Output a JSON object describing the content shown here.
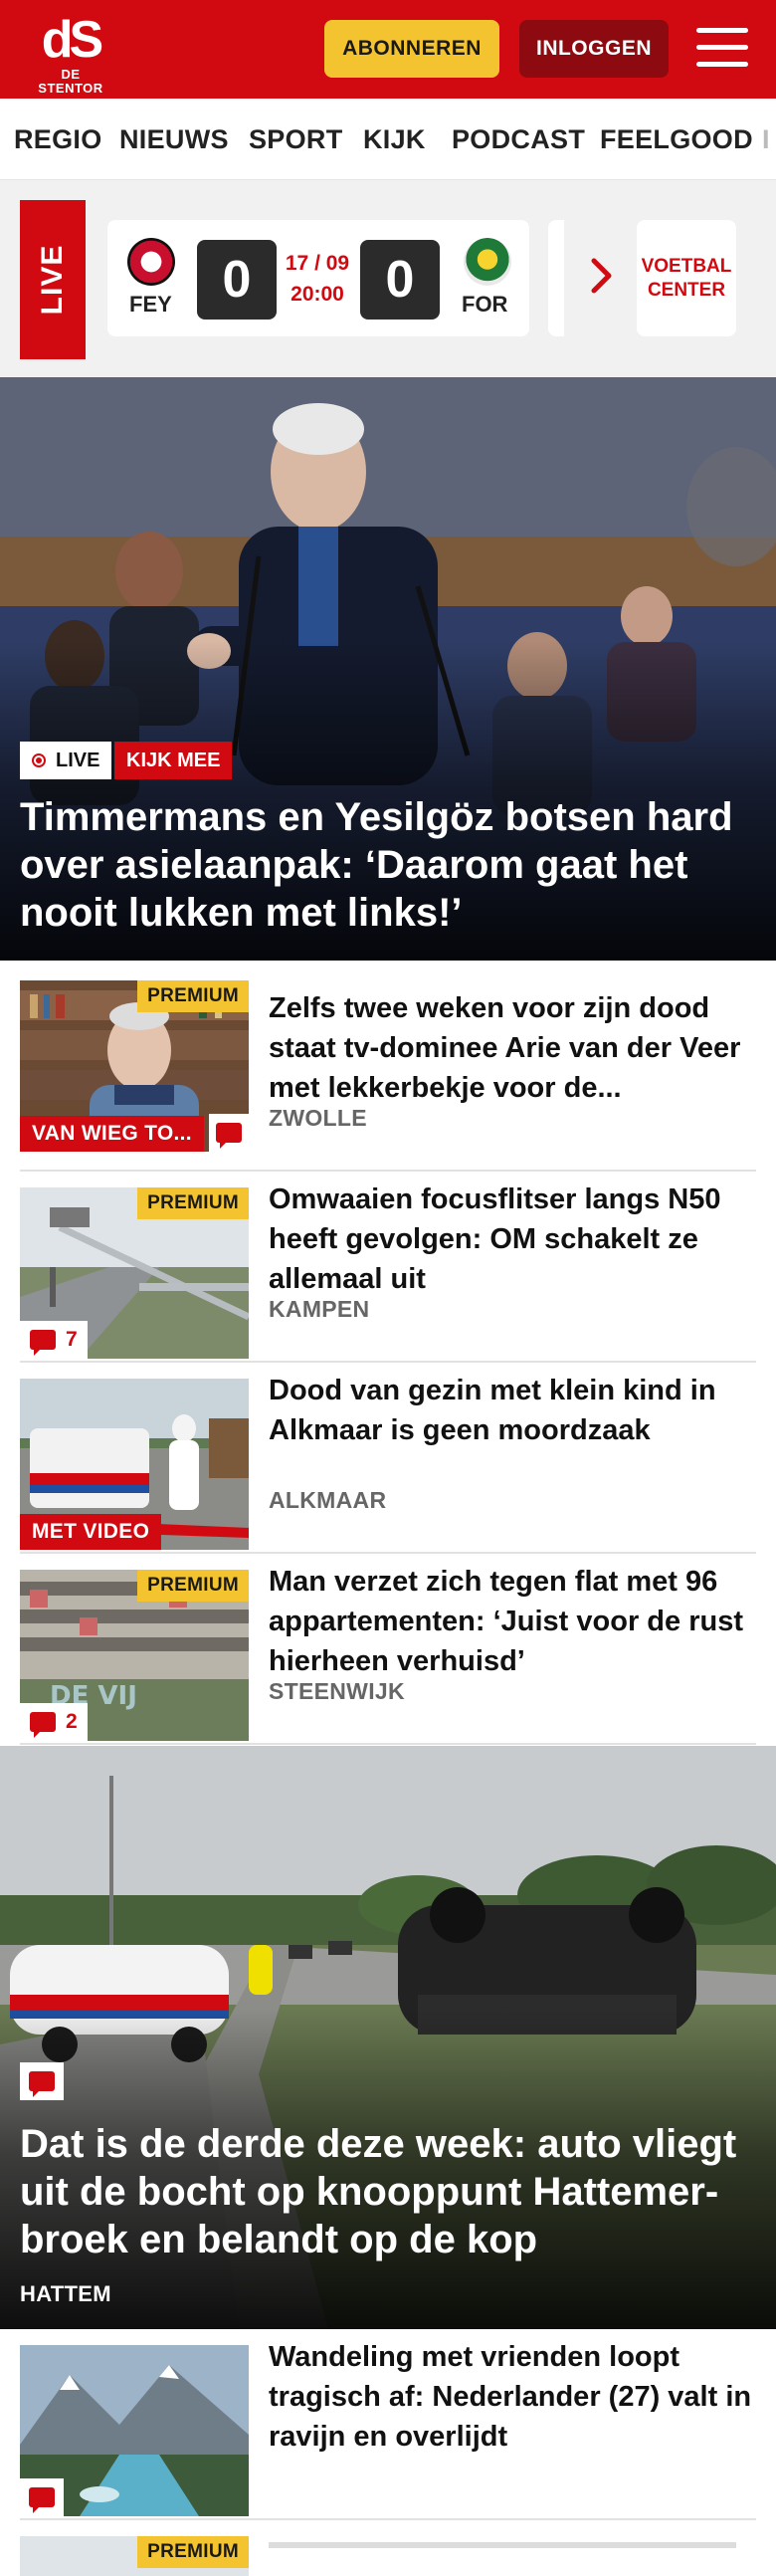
{
  "header": {
    "logo_mark": "dS",
    "logo_sub": "DE STENTOR",
    "subscribe_label": "ABONNEREN",
    "login_label": "INLOGGEN",
    "brand_color": "#d10a11"
  },
  "nav": {
    "items": [
      "REGIO",
      "NIEUWS",
      "SPORT",
      "KIJK",
      "PODCAST",
      "FEELGOOD",
      "I"
    ]
  },
  "live_scores": {
    "label": "LIVE",
    "match": {
      "home": "FEY",
      "away": "FOR",
      "home_score": "0",
      "away_score": "0",
      "date": "17 / 09",
      "time": "20:00"
    },
    "voetbal_center": "VOETBAL CENTER"
  },
  "hero": {
    "badge_live": "LIVE",
    "badge_watch": "KIJK MEE",
    "title": "Timmermans en Yesilgöz botsen hard over asielaanpak: ‘Daarom gaat het nooit lukken met links!’"
  },
  "articles": [
    {
      "premium": "PREMIUM",
      "tag": "VAN WIEG TO...",
      "title": "Zelfs twee weken voor zijn dood staat tv-dominee Arie van der Veer met lekkerbekje voor de...",
      "location": "ZWOLLE"
    },
    {
      "premium": "PREMIUM",
      "comments": "7",
      "title": "Omwaaien focusflitser langs N50 heeft gevolgen: OM schakelt ze allemaal uit",
      "location": "KAMPEN"
    },
    {
      "tag": "MET VIDEO",
      "title": "Dood van gezin met klein kind in Alkmaar is geen moordzaak",
      "location": "ALKMAAR"
    },
    {
      "premium": "PREMIUM",
      "comments": "2",
      "title": "Man verzet zich tegen flat met 96 appartementen: ‘Juist voor de rust hierheen verhuisd’",
      "location": "STEENWIJK"
    }
  ],
  "hero2": {
    "title": "Dat is de derde deze week: auto vliegt uit de bocht op knooppunt Hattemer­broek en belandt op de kop",
    "location": "HATTEM"
  },
  "article_last": {
    "title": "Wandeling met vrienden loopt tragisch af: Nederlander (27) valt in ravijn en overlijdt"
  },
  "article_partial": {
    "premium": "PREMIUM"
  }
}
